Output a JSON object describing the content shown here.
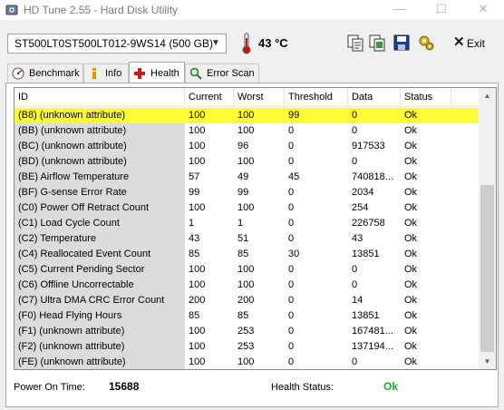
{
  "window": {
    "title": "HD Tune 2.55 - Hard Disk Utility",
    "min_glyph": "—",
    "max_glyph": "☐",
    "close_glyph": "✕"
  },
  "toolbar": {
    "drive": "ST500LT0ST500LT012-9WS14 (500 GB)",
    "temperature": "43 °C",
    "exit_label": "Exit"
  },
  "tabs": [
    {
      "label": "Benchmark",
      "icon": "speedometer-icon"
    },
    {
      "label": "Info",
      "icon": "info-icon"
    },
    {
      "label": "Health",
      "icon": "health-cross-icon",
      "active": true
    },
    {
      "label": "Error Scan",
      "icon": "magnifier-icon"
    }
  ],
  "table": {
    "columns": [
      "ID",
      "Current",
      "Worst",
      "Threshold",
      "Data",
      "Status"
    ],
    "rows": [
      {
        "id": "(B8) (unknown attribute)",
        "current": "100",
        "worst": "100",
        "threshold": "99",
        "data": "0",
        "status": "Ok",
        "selected": true
      },
      {
        "id": "(BB) (unknown attribute)",
        "current": "100",
        "worst": "100",
        "threshold": "0",
        "data": "0",
        "status": "Ok"
      },
      {
        "id": "(BC) (unknown attribute)",
        "current": "100",
        "worst": "96",
        "threshold": "0",
        "data": "917533",
        "status": "Ok"
      },
      {
        "id": "(BD) (unknown attribute)",
        "current": "100",
        "worst": "100",
        "threshold": "0",
        "data": "0",
        "status": "Ok"
      },
      {
        "id": "(BE) Airflow Temperature",
        "current": "57",
        "worst": "49",
        "threshold": "45",
        "data": "740818...",
        "status": "Ok"
      },
      {
        "id": "(BF) G-sense Error Rate",
        "current": "99",
        "worst": "99",
        "threshold": "0",
        "data": "2034",
        "status": "Ok"
      },
      {
        "id": "(C0) Power Off Retract Count",
        "current": "100",
        "worst": "100",
        "threshold": "0",
        "data": "254",
        "status": "Ok"
      },
      {
        "id": "(C1) Load Cycle Count",
        "current": "1",
        "worst": "1",
        "threshold": "0",
        "data": "226758",
        "status": "Ok"
      },
      {
        "id": "(C2) Temperature",
        "current": "43",
        "worst": "51",
        "threshold": "0",
        "data": "43",
        "status": "Ok"
      },
      {
        "id": "(C4) Reallocated Event Count",
        "current": "85",
        "worst": "85",
        "threshold": "30",
        "data": "13851",
        "status": "Ok"
      },
      {
        "id": "(C5) Current Pending Sector",
        "current": "100",
        "worst": "100",
        "threshold": "0",
        "data": "0",
        "status": "Ok"
      },
      {
        "id": "(C6) Offline Uncorrectable",
        "current": "100",
        "worst": "100",
        "threshold": "0",
        "data": "0",
        "status": "Ok"
      },
      {
        "id": "(C7) Ultra DMA CRC Error Count",
        "current": "200",
        "worst": "200",
        "threshold": "0",
        "data": "14",
        "status": "Ok"
      },
      {
        "id": "(F0) Head Flying Hours",
        "current": "85",
        "worst": "85",
        "threshold": "0",
        "data": "13851",
        "status": "Ok"
      },
      {
        "id": "(F1) (unknown attribute)",
        "current": "100",
        "worst": "253",
        "threshold": "0",
        "data": "167481...",
        "status": "Ok"
      },
      {
        "id": "(F2) (unknown attribute)",
        "current": "100",
        "worst": "253",
        "threshold": "0",
        "data": "137194...",
        "status": "Ok"
      },
      {
        "id": "(FE) (unknown attribute)",
        "current": "100",
        "worst": "100",
        "threshold": "0",
        "data": "0",
        "status": "Ok"
      }
    ]
  },
  "footer": {
    "power_on_label": "Power On Time:",
    "power_on_value": "15688",
    "health_label": "Health Status:",
    "health_value": "Ok",
    "health_color": "#22aa22"
  },
  "colors": {
    "selected_row": "#ffff33",
    "id_column_bg": "#dcdcdc"
  }
}
